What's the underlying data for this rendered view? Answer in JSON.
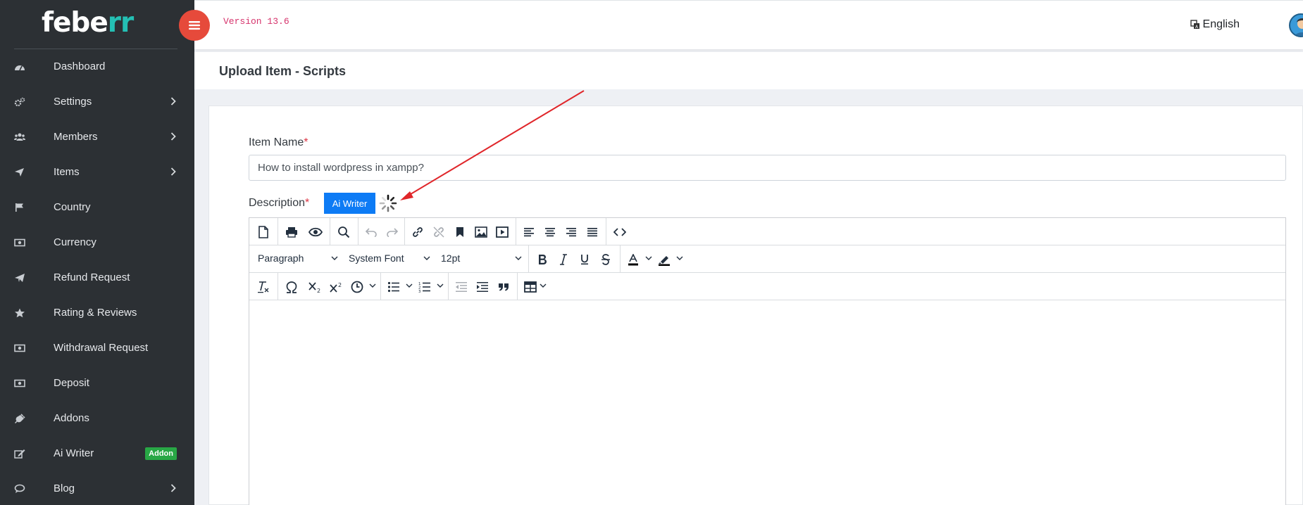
{
  "brand": {
    "name_part1": "febe",
    "name_part2": "rr"
  },
  "topbar": {
    "version": "Version 13.6",
    "language": "English"
  },
  "sidebar": {
    "items": [
      {
        "label": "Dashboard",
        "icon": "dashboard-icon",
        "chevron": false
      },
      {
        "label": "Settings",
        "icon": "cogs-icon",
        "chevron": true
      },
      {
        "label": "Members",
        "icon": "users-icon",
        "chevron": true
      },
      {
        "label": "Items",
        "icon": "send-icon",
        "chevron": true
      },
      {
        "label": "Country",
        "icon": "flag-icon",
        "chevron": false
      },
      {
        "label": "Currency",
        "icon": "money-icon",
        "chevron": false
      },
      {
        "label": "Refund Request",
        "icon": "paper-plane-icon",
        "chevron": false
      },
      {
        "label": "Rating & Reviews",
        "icon": "star-icon",
        "chevron": false
      },
      {
        "label": "Withdrawal Request",
        "icon": "money-icon",
        "chevron": false
      },
      {
        "label": "Deposit",
        "icon": "money-icon",
        "chevron": false
      },
      {
        "label": "Addons",
        "icon": "plug-icon",
        "chevron": false
      },
      {
        "label": "Ai Writer",
        "icon": "edit-icon",
        "chevron": false,
        "badge": "Addon"
      },
      {
        "label": "Blog",
        "icon": "comments-icon",
        "chevron": true
      }
    ]
  },
  "page": {
    "title": "Upload Item - Scripts"
  },
  "form": {
    "item_name_label": "Item Name",
    "required_mark": "*",
    "item_name_value": "How to install wordpress in xampp?",
    "description_label": "Description",
    "ai_writer_button": "Ai Writer"
  },
  "editor": {
    "block_format": "Paragraph",
    "font_family": "System Font",
    "font_size": "12pt"
  },
  "colors": {
    "sidebar_bg": "#2c3034",
    "brand_accent": "#24c0b4",
    "menu_button": "#e64a3b",
    "ai_button": "#0d7bf5",
    "addon_badge": "#28a745",
    "annotation_arrow": "#e0262a"
  }
}
